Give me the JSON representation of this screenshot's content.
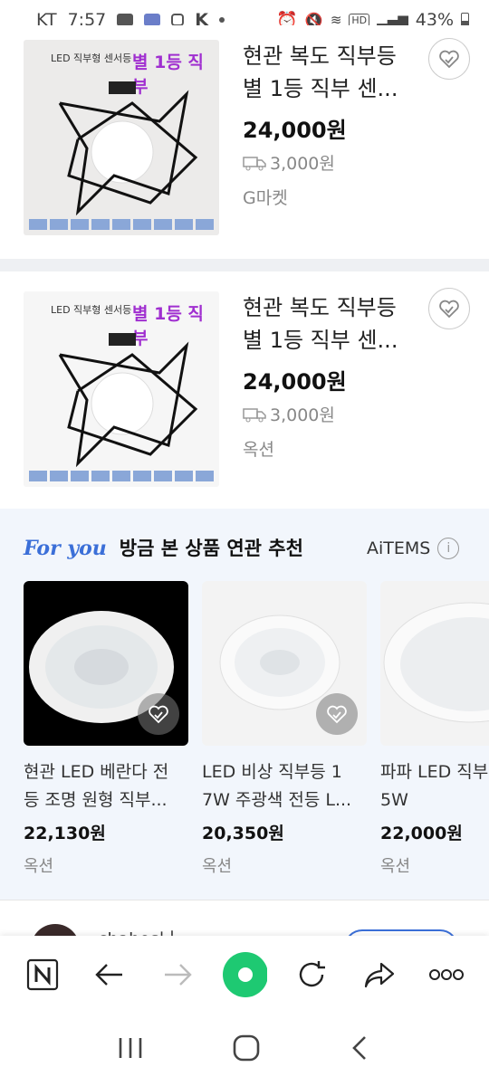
{
  "status_bar": {
    "carrier": "KT",
    "time": "7:57",
    "battery": "43%",
    "icons": [
      "youtube-icon",
      "news-icon",
      "instagram-icon",
      "app-icon",
      "dot-icon",
      "alarm-icon",
      "mute-icon",
      "wifi-icon",
      "hd-icon",
      "signal-icon",
      "battery-icon"
    ]
  },
  "products": [
    {
      "title": "현관 복도 직부등 별 1등 직부 센...",
      "title_line1": "현관 복도 직부등",
      "title_line2": "별 1등 직부 센...",
      "price": "24,000원",
      "shipping": "3,000원",
      "seller": "G마켓",
      "image_top_text": "LED 직부형 센서등",
      "image_big_text": "별 1등 직부"
    },
    {
      "title": "현관 복도 직부등 별 1등 직부 센...",
      "title_line1": "현관 복도 직부등",
      "title_line2": "별 1등 직부 센...",
      "price": "24,000원",
      "shipping": "3,000원",
      "seller": "옥션",
      "image_top_text": "LED 직부형 센서등",
      "image_big_text": "별 1등 직부"
    }
  ],
  "recommend": {
    "brand": "For you",
    "title": "방금 본 상품 연관 추천",
    "provider": "AiTEMS",
    "items": [
      {
        "title_line1": "현관 LED 베란다 전",
        "title_line2": "등 조명 원형 직부...",
        "price": "22,130원",
        "seller": "옥션"
      },
      {
        "title_line1": "LED 비상 직부등 1",
        "title_line2": "7W 주광색 전등 L...",
        "price": "20,350원",
        "seller": "옥션"
      },
      {
        "title_line1": "파파 LED 직부",
        "title_line2": "5W",
        "price": "22,000원",
        "seller": "옥션"
      }
    ]
  },
  "below_row": {
    "name": "chahos님"
  },
  "toolbar": {
    "icons": [
      "naver-icon",
      "back-arrow-icon",
      "forward-arrow-icon",
      "home-green-circle-icon",
      "refresh-icon",
      "share-icon",
      "more-icon"
    ]
  },
  "colors": {
    "accent_blue": "#3b6fd8",
    "green": "#1ec972",
    "price": "#111111",
    "muted": "#888888"
  }
}
